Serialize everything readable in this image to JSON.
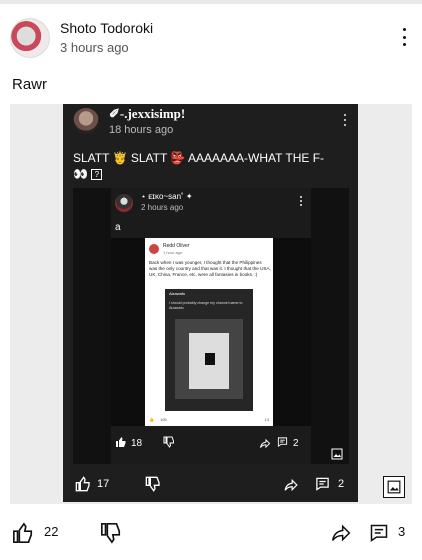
{
  "outer": {
    "author": "Shoto Todoroki",
    "time": "3 hours ago",
    "text": "Rawr",
    "likes": "22",
    "comments": "3"
  },
  "repost1": {
    "author": "✐-.jexxisimp!",
    "time": "18 hours ago",
    "text": "SLATT 🤴 SLATT 👺 AAAAAAA-WHAT THE F-",
    "text_tail": "👀",
    "emoji_box": "?",
    "likes": "17",
    "comments": "2"
  },
  "repost2": {
    "author": "⋆ ᴇɪᴋᴏ~san˚ ✦",
    "time": "2 hours ago",
    "text": "a",
    "likes": "18",
    "comments": "2"
  },
  "reddit_card": {
    "author": "Redd Oliver",
    "time": "1 hour ago",
    "body": "Back when I was younger, I thought that the Philippines was the only country and that was it. I thought that the USA, UK, China, France, etc, were all fantasies in books. :)",
    "inner_author": "Aizawafu",
    "inner_text": "I should probably change my channel name to Aizawafu",
    "inner_likes": "105",
    "inner_comments": "13"
  }
}
